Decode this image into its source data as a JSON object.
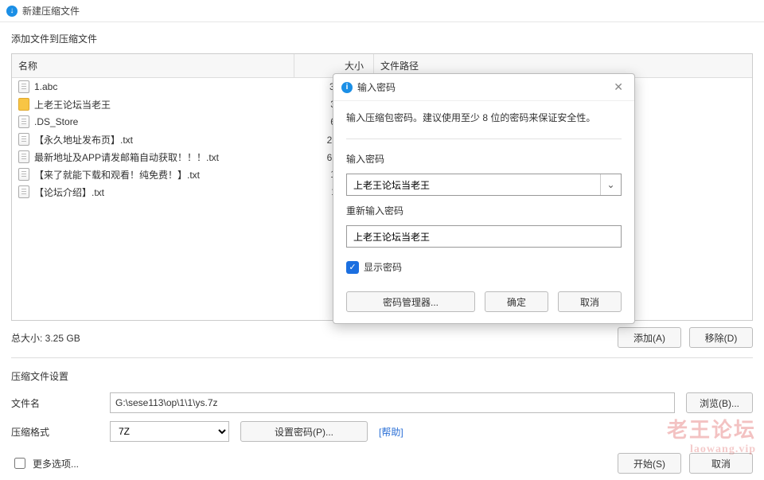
{
  "window": {
    "title": "新建压缩文件"
  },
  "add_section": {
    "label": "添加文件到压缩文件"
  },
  "table": {
    "headers": {
      "name": "名称",
      "size": "大小",
      "path": "文件路径"
    },
    "rows": [
      {
        "icon": "doc",
        "name": "1.abc",
        "size": "3.25 GB"
      },
      {
        "icon": "folder",
        "name": "上老王论坛当老王",
        "size": "3.09 KB"
      },
      {
        "icon": "doc",
        "name": ".DS_Store",
        "size": "6.00 KB"
      },
      {
        "icon": "doc",
        "name": "【永久地址发布页】.txt",
        "size": "215 字节"
      },
      {
        "icon": "doc",
        "name": "最新地址及APP请发邮箱自动获取！！！.txt",
        "size": "669 字节"
      },
      {
        "icon": "doc",
        "name": "【来了就能下载和观看！纯免费！】.txt",
        "size": "1.12 KB"
      },
      {
        "icon": "doc",
        "name": "【论坛介绍】.txt",
        "size": "1.11 KB"
      }
    ]
  },
  "totals": {
    "label": "总大小: 3.25 GB"
  },
  "buttons": {
    "add": "添加(A)",
    "remove": "移除(D)"
  },
  "settings": {
    "section": "压缩文件设置",
    "filename_label": "文件名",
    "filename_value": "G:\\sese113\\op\\1\\1\\ys.7z",
    "browse": "浏览(B)...",
    "format_label": "压缩格式",
    "format_value": "7Z",
    "set_password": "设置密码(P)...",
    "help": "[帮助]"
  },
  "bottom": {
    "more_options": "更多选项...",
    "start": "开始(S)",
    "cancel": "取消"
  },
  "dialog": {
    "title": "输入密码",
    "message": "输入压缩包密码。建议使用至少 8 位的密码来保证安全性。",
    "pw1_label": "输入密码",
    "pw1_value": "上老王论坛当老王",
    "pw2_label": "重新输入密码",
    "pw2_value": "上老王论坛当老王",
    "show_pw": "显示密码",
    "pw_manager": "密码管理器...",
    "ok": "确定",
    "cancel": "取消"
  },
  "watermark": {
    "line1": "老王论坛",
    "line2": "laowang.vip"
  }
}
